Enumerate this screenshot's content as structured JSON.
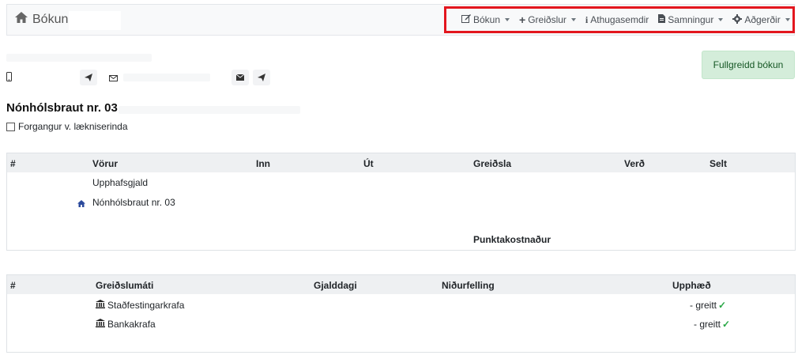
{
  "navbar": {
    "brand": "Bókun",
    "menu": [
      {
        "label": "Bókun",
        "icon": "edit-icon",
        "has_caret": true
      },
      {
        "label": "Greiðslur",
        "icon": "plus-icon",
        "has_caret": true
      },
      {
        "label": "Athugasemdir",
        "icon": "info-icon",
        "has_caret": false
      },
      {
        "label": "Samningur",
        "icon": "document-icon",
        "has_caret": true
      },
      {
        "label": "Aðgerðir",
        "icon": "gear-icon",
        "has_caret": true
      }
    ]
  },
  "status": {
    "label": "Fullgreidd bókun",
    "color": "#d4edda"
  },
  "property": {
    "title": "Nónhólsbraut nr. 03",
    "priority_label": "Forgangur v. lækniserinda"
  },
  "products": {
    "headers": [
      "#",
      "Vörur",
      "Inn",
      "Út",
      "Greiðsla",
      "Verð",
      "Selt"
    ],
    "rows": [
      {
        "name": "Upphafsgjald"
      },
      {
        "name": "Nónhólsbraut nr. 03"
      }
    ],
    "footer_label": "Punktakostnaður"
  },
  "payments": {
    "headers": [
      "#",
      "Greiðslumáti",
      "Gjalddagi",
      "Niðurfelling",
      "Upphæð"
    ],
    "rows": [
      {
        "method": "Staðfestingarkrafa",
        "amount": "- greitt"
      },
      {
        "method": "Bankakrafa",
        "amount": "- greitt"
      }
    ]
  },
  "colors": {
    "accent_border": "#e3161e",
    "success": "#28a745"
  }
}
